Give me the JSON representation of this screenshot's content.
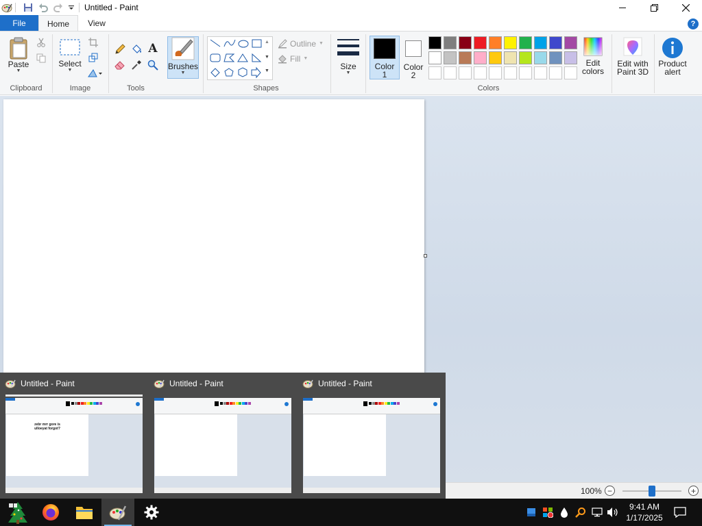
{
  "window": {
    "title": "Untitled - Paint",
    "controls": {
      "minimize": "minimize",
      "maximize": "maximize",
      "close": "close"
    }
  },
  "quick_access": {
    "icons": [
      "paint-app-icon",
      "save-icon",
      "undo-icon",
      "redo-icon",
      "customize-qat-icon"
    ]
  },
  "ribbon_tabs": {
    "file": "File",
    "home": "Home",
    "view": "View",
    "help": "?"
  },
  "ribbon": {
    "clipboard": {
      "group_label": "Clipboard",
      "paste": "Paste",
      "cut_icon": "scissors-icon",
      "copy_icon": "copy-icon"
    },
    "image": {
      "group_label": "Image",
      "select": "Select",
      "crop_icon": "crop-icon",
      "resize_icon": "resize-icon",
      "rotate_icon": "rotate-icon"
    },
    "tools": {
      "group_label": "Tools",
      "pencil_icon": "pencil-icon",
      "fill_icon": "fill-bucket-icon",
      "text_icon": "A",
      "eraser_icon": "eraser-icon",
      "picker_icon": "color-picker-icon",
      "magnifier_icon": "magnifier-icon"
    },
    "brushes": {
      "label": "Brushes"
    },
    "shapes": {
      "group_label": "Shapes",
      "outline": "Outline",
      "fill": "Fill"
    },
    "size": {
      "label": "Size"
    },
    "colors": {
      "group_label": "Colors",
      "color1_label_line1": "Color",
      "color1_label_line2": "1",
      "color2_label_line1": "Color",
      "color2_label_line2": "2",
      "color1_value": "#000000",
      "color2_value": "#ffffff",
      "palette_row1": [
        "#000000",
        "#7f7f7f",
        "#880015",
        "#ed1c24",
        "#ff7f27",
        "#fff200",
        "#22b14c",
        "#00a2e8",
        "#3f48cc",
        "#a349a4"
      ],
      "palette_row2": [
        "#ffffff",
        "#c3c3c3",
        "#b97a57",
        "#ffaec9",
        "#ffc90e",
        "#efe4b0",
        "#b5e61d",
        "#99d9ea",
        "#7092be",
        "#c8bfe7"
      ],
      "empty_slots": 10,
      "edit_colors_line1": "Edit",
      "edit_colors_line2": "colors"
    },
    "paint3d": {
      "line1": "Edit with",
      "line2": "Paint 3D"
    },
    "product_alert": {
      "line1": "Product",
      "line2": "alert"
    }
  },
  "statusbar": {
    "zoom": "100%",
    "zoom_percent": 100
  },
  "preview_popup": {
    "thumbnails": [
      {
        "title": "Untitled - Paint",
        "canvas_text": "zebr mrr gore is ulloeyat forgot?"
      },
      {
        "title": "Untitled - Paint",
        "canvas_text": ""
      },
      {
        "title": "Untitled - Paint",
        "canvas_text": ""
      }
    ]
  },
  "taskbar": {
    "apps": [
      "start-icon",
      "firefox-icon",
      "file-explorer-icon",
      "paint-icon",
      "settings-icon"
    ],
    "tray_icons": [
      "display-icon",
      "app-tray-icon",
      "droplet-icon",
      "search-tray-icon",
      "network-icon",
      "volume-icon"
    ],
    "time": "9:41 AM",
    "date": "1/17/2025",
    "notification_icon": "notification-icon"
  }
}
